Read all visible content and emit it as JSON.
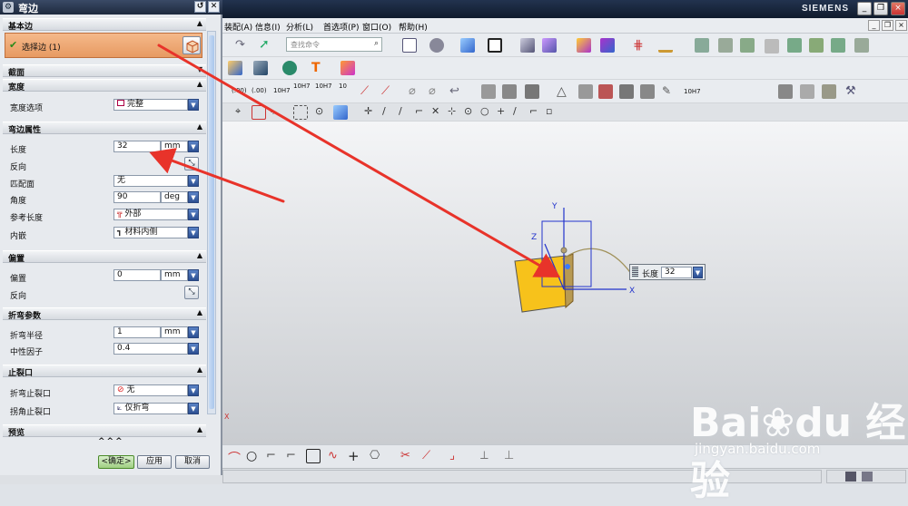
{
  "window": {
    "brand": "SIEMENS",
    "controls": [
      "_",
      "❐",
      "×"
    ],
    "inner_controls": [
      "_",
      "❐",
      "×"
    ]
  },
  "menu": {
    "items": [
      "装配(A)",
      "信息(I)",
      "分析(L)",
      "首选项(P)",
      "窗口(O)",
      "帮助(H)"
    ]
  },
  "toolbar": {
    "search_placeholder": "查找命令",
    "dimension_labels": [
      "(.00)",
      "(.00)",
      "10H7",
      "10H7",
      "10H7",
      "10",
      "10H7"
    ]
  },
  "dialog": {
    "title": "弯边",
    "sections": {
      "base_edge": "基本边",
      "profile": "截面",
      "width": "宽度",
      "flange_props": "弯边属性",
      "offset": "偏置",
      "bend_params": "折弯参数",
      "relief": "止裂口",
      "preview": "预览"
    },
    "select_edge": {
      "label": "选择边 (1)"
    },
    "width_option": {
      "label": "宽度选项",
      "value": "完整"
    },
    "flange": {
      "length": {
        "label": "长度",
        "value": "32",
        "unit": "mm"
      },
      "reverse": {
        "label": "反向"
      },
      "match_face": {
        "label": "匹配面",
        "value": "无"
      },
      "angle": {
        "label": "角度",
        "value": "90",
        "unit": "deg"
      },
      "ref_length": {
        "label": "参考长度",
        "value": "外部"
      },
      "inset": {
        "label": "内嵌",
        "value": "材料内侧"
      }
    },
    "offset": {
      "offset": {
        "label": "偏置",
        "value": "0",
        "unit": "mm"
      },
      "reverse": {
        "label": "反向"
      }
    },
    "bend": {
      "radius": {
        "label": "折弯半径",
        "value": "1",
        "unit": "mm"
      },
      "neutral": {
        "label": "中性因子",
        "value": "0.4"
      }
    },
    "relief": {
      "bend_relief": {
        "label": "折弯止裂口",
        "value": "无"
      },
      "corner_relief": {
        "label": "拐角止裂口",
        "value": "仅折弯"
      }
    },
    "buttons": {
      "ok": "<确定>",
      "apply": "应用",
      "cancel": "取消"
    }
  },
  "viewport": {
    "length_tag": {
      "label": "长度",
      "value": "32"
    },
    "axes": {
      "x": "X",
      "y": "Y",
      "z": "Z"
    }
  },
  "watermark": {
    "brand": "Bai du 经验",
    "url": "jingyan.baidu.com"
  },
  "colors": {
    "accent_orange": "#e79a62",
    "arrow_red": "#e8332a",
    "part_yellow": "#f7c21b"
  }
}
